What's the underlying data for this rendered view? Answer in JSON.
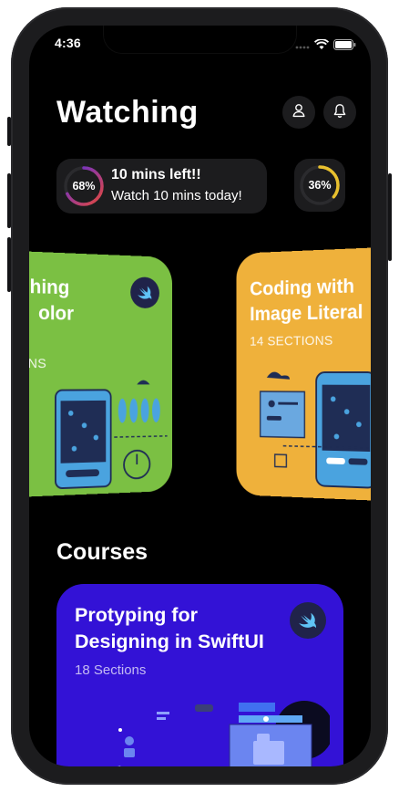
{
  "status": {
    "time": "4:36"
  },
  "header": {
    "title": "Watching"
  },
  "progress": {
    "main": {
      "percent_label": "68%",
      "value": 0.68,
      "line1": "10 mins left!!",
      "line2": "Watch 10 mins today!"
    },
    "secondary": {
      "percent_label": "36%",
      "value": 0.36
    }
  },
  "watching_cards": [
    {
      "title_line1": "hing",
      "title_line2": "olor",
      "subtitle": "NS",
      "color": "#7bc043"
    },
    {
      "title_line1": "Coding with",
      "title_line2": "Image Literal",
      "subtitle": "14 SECTIONS",
      "color": "#efb13b"
    }
  ],
  "courses": {
    "heading": "Courses",
    "items": [
      {
        "title": "Protyping for Designing in SwiftUI",
        "subtitle": "18 Sections",
        "color": "#3312d6"
      }
    ]
  },
  "icons": {
    "account": "person-icon",
    "notifications": "bell-icon",
    "swift": "swift-logo-icon"
  }
}
